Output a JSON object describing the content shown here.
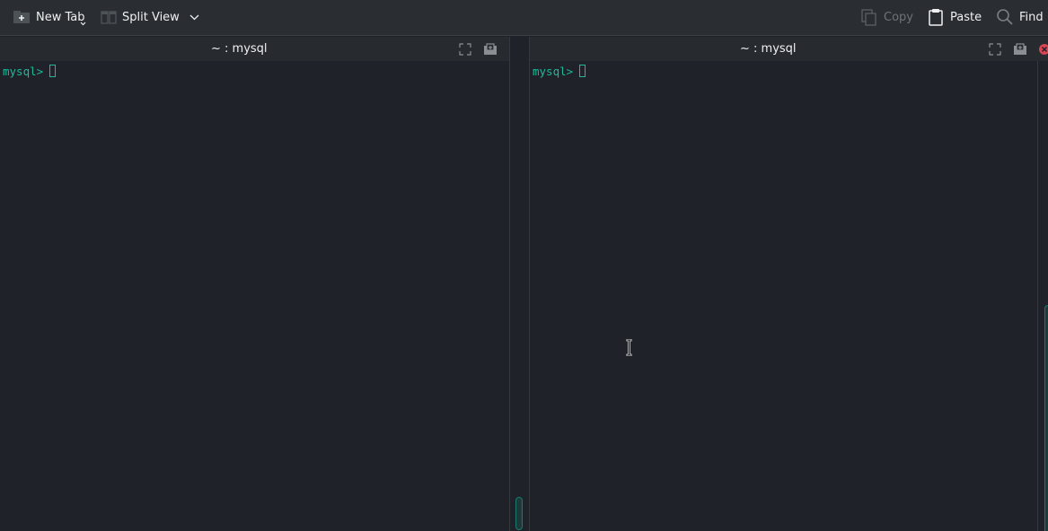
{
  "toolbar": {
    "new_tab": {
      "label": "New Tab",
      "icon": "new-tab-icon"
    },
    "split_view": {
      "label": "Split View",
      "icon": "split-view-icon"
    },
    "copy": {
      "label": "Copy",
      "icon": "copy-icon",
      "enabled": false
    },
    "paste": {
      "label": "Paste",
      "icon": "paste-icon"
    },
    "find": {
      "label": "Find",
      "icon": "search-icon"
    }
  },
  "panes": [
    {
      "title": "~ : mysql",
      "prompt": "mysql>"
    },
    {
      "title": "~ : mysql",
      "prompt": "mysql>"
    }
  ],
  "colors": {
    "background": "#1f2228",
    "toolbar": "#2a2e32",
    "pane_header": "#272b30",
    "prompt": "#1abc9c",
    "close": "#da4453",
    "text": "#eff0f1"
  }
}
